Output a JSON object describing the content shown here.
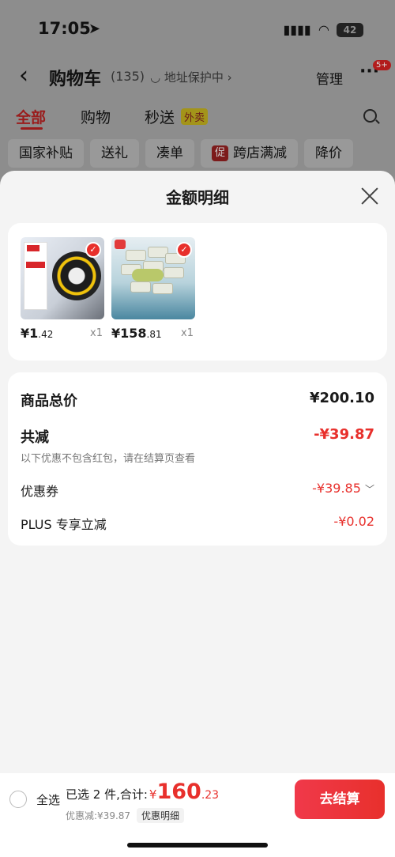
{
  "status": {
    "time": "17:05",
    "battery": "42"
  },
  "nav": {
    "title": "购物车",
    "count": "(135)",
    "address": "地址保护中",
    "manage": "管理",
    "more_badge": "5+"
  },
  "tabs": [
    "全部",
    "购物",
    "秒送"
  ],
  "waimai_tag": "外卖",
  "filters": [
    "国家补贴",
    "送礼",
    "凑单",
    "跨店满减",
    "降价"
  ],
  "filter_tag": "促",
  "sheet": {
    "title": "金额明细",
    "products": [
      {
        "price_int": "¥1",
        "price_dec": ".42",
        "qty": "x1",
        "name": "deli tape"
      },
      {
        "price_int": "¥158",
        "price_dec": ".81",
        "qty": "x1",
        "name": "wet wipes"
      }
    ],
    "summary": {
      "total_label": "商品总价",
      "total_value": "¥200.10",
      "reduce_label": "共减",
      "reduce_value": "-¥39.87",
      "note": "以下优惠不包含红包，请在结算页查看",
      "coupon_label": "优惠券",
      "coupon_value": "-¥39.85",
      "plus_label": "PLUS 专享立减",
      "plus_value": "-¥0.02"
    }
  },
  "bottom": {
    "select_all": "全选",
    "selected_label": "已选 2 件,合计:",
    "yen": "¥",
    "amount": "160",
    "decimal": ".23",
    "discount": "优惠减:¥39.87",
    "detail": "优惠明细",
    "checkout": "去结算"
  },
  "colors": {
    "accent": "#e8302c"
  }
}
